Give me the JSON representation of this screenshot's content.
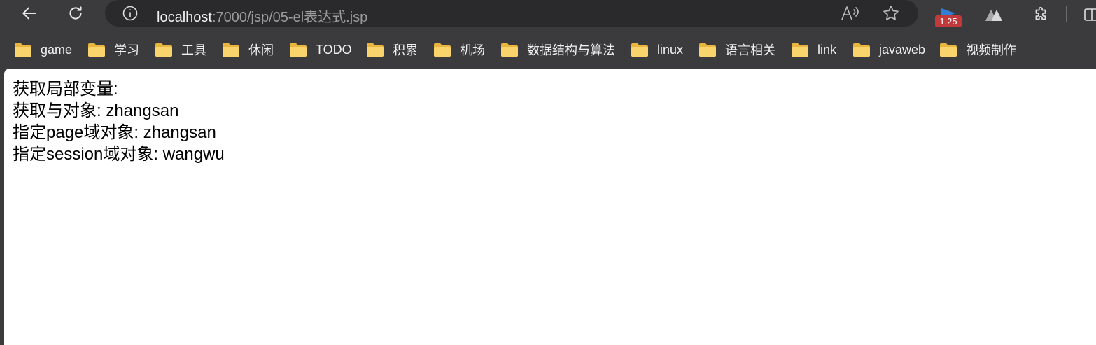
{
  "browser": {
    "back_icon": "arrow-left",
    "refresh_icon": "refresh",
    "address": {
      "host": "localhost",
      "path": ":7000/jsp/05-el表达式.jsp"
    },
    "extensions": {
      "speed_badge": "1.25"
    },
    "accent_badge_color": "#c0393b"
  },
  "bookmarks": [
    {
      "label": "game"
    },
    {
      "label": "学习"
    },
    {
      "label": "工具"
    },
    {
      "label": "休闲"
    },
    {
      "label": "TODO"
    },
    {
      "label": "积累"
    },
    {
      "label": "机场"
    },
    {
      "label": "数据结构与算法"
    },
    {
      "label": "linux"
    },
    {
      "label": "语言相关"
    },
    {
      "label": "link"
    },
    {
      "label": "javaweb"
    },
    {
      "label": "视频制作"
    }
  ],
  "content": {
    "lines": [
      "获取局部变量:",
      "获取与对象: zhangsan",
      "指定page域对象: zhangsan",
      "指定session域对象: wangwu"
    ]
  }
}
